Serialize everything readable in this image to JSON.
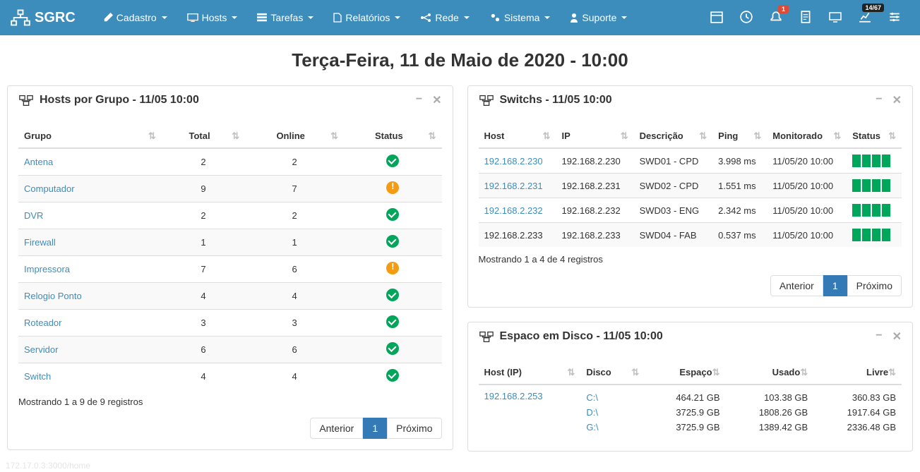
{
  "brand": "SGRC",
  "nav": {
    "items": [
      {
        "label": "Cadastro",
        "icon": "pencil"
      },
      {
        "label": "Hosts",
        "icon": "desktop"
      },
      {
        "label": "Tarefas",
        "icon": "tasks"
      },
      {
        "label": "Relatórios",
        "icon": "file"
      },
      {
        "label": "Rede",
        "icon": "share"
      },
      {
        "label": "Sistema",
        "icon": "cogs"
      },
      {
        "label": "Suporte",
        "icon": "user"
      }
    ]
  },
  "icon_badges": {
    "bell": "1",
    "chart": "14/67"
  },
  "page_title": "Terça-Feira, 11 de Maio de 2020 - 10:00",
  "panel_hosts": {
    "title": "Hosts por Grupo - 11/05 10:00",
    "columns": [
      "Grupo",
      "Total",
      "Online",
      "Status"
    ],
    "rows": [
      {
        "grupo": "Antena",
        "total": "2",
        "online": "2",
        "status": "ok"
      },
      {
        "grupo": "Computador",
        "total": "9",
        "online": "7",
        "status": "warn"
      },
      {
        "grupo": "DVR",
        "total": "2",
        "online": "2",
        "status": "ok"
      },
      {
        "grupo": "Firewall",
        "total": "1",
        "online": "1",
        "status": "ok"
      },
      {
        "grupo": "Impressora",
        "total": "7",
        "online": "6",
        "status": "warn"
      },
      {
        "grupo": "Relogio Ponto",
        "total": "4",
        "online": "4",
        "status": "ok"
      },
      {
        "grupo": "Roteador",
        "total": "3",
        "online": "3",
        "status": "ok"
      },
      {
        "grupo": "Servidor",
        "total": "6",
        "online": "6",
        "status": "ok"
      },
      {
        "grupo": "Switch",
        "total": "4",
        "online": "4",
        "status": "ok"
      }
    ],
    "info": "Mostrando 1 a 9 de 9 registros",
    "pagination": {
      "prev": "Anterior",
      "page": "1",
      "next": "Próximo"
    }
  },
  "panel_switchs": {
    "title": "Switchs - 11/05 10:00",
    "columns": [
      "Host",
      "IP",
      "Descrição",
      "Ping",
      "Monitorado",
      "Status"
    ],
    "rows": [
      {
        "host": "192.168.2.230",
        "ip": "192.168.2.230",
        "desc": "SWD01 - CPD",
        "ping": "3.998 ms",
        "mon": "11/05/20 10:00",
        "link": true
      },
      {
        "host": "192.168.2.231",
        "ip": "192.168.2.231",
        "desc": "SWD02 - CPD",
        "ping": "1.551 ms",
        "mon": "11/05/20 10:00",
        "link": true
      },
      {
        "host": "192.168.2.232",
        "ip": "192.168.2.232",
        "desc": "SWD03 - ENG",
        "ping": "2.342 ms",
        "mon": "11/05/20 10:00",
        "link": true
      },
      {
        "host": "192.168.2.233",
        "ip": "192.168.2.233",
        "desc": "SWD04 - FAB",
        "ping": "0.537 ms",
        "mon": "11/05/20 10:00",
        "link": false
      }
    ],
    "info": "Mostrando 1 a 4 de 4 registros",
    "pagination": {
      "prev": "Anterior",
      "page": "1",
      "next": "Próximo"
    }
  },
  "panel_disk": {
    "title": "Espaco em Disco - 11/05 10:00",
    "columns": [
      "Host (IP)",
      "Disco",
      "Espaço",
      "Usado",
      "Livre"
    ],
    "rows": [
      {
        "host": "192.168.2.253",
        "disks": [
          "C:\\",
          "D:\\",
          "G:\\"
        ],
        "espaco": [
          "464.21 GB",
          "3725.9 GB",
          "3725.9 GB"
        ],
        "usado": [
          "103.38 GB",
          "1808.26 GB",
          "1389.42 GB"
        ],
        "livre": [
          "360.83 GB",
          "1917.64 GB",
          "2336.48 GB"
        ]
      }
    ]
  },
  "footer": "172.17.0.3:3000/home"
}
